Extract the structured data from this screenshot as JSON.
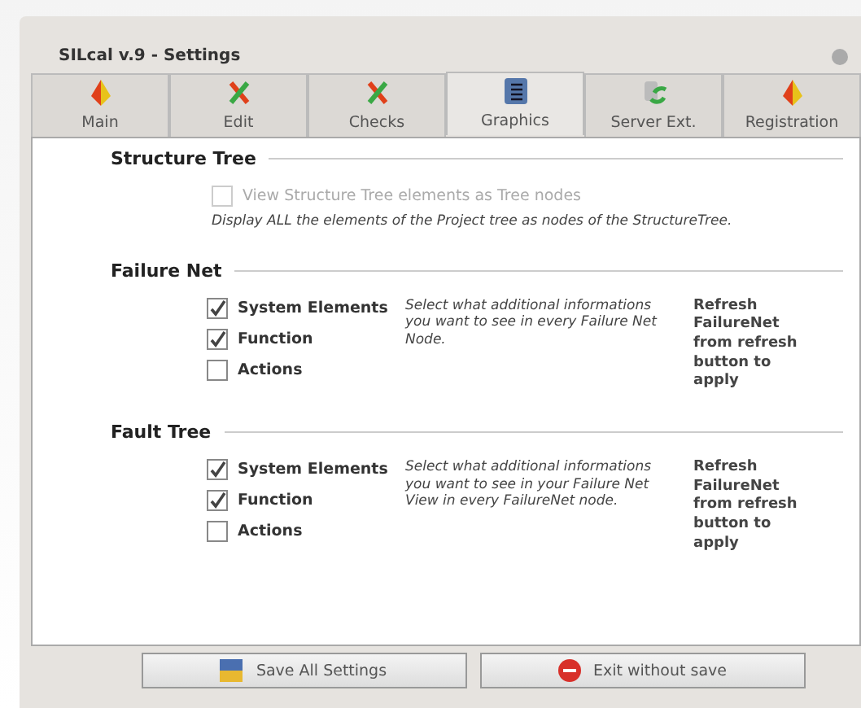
{
  "window": {
    "title": "SILcal v.9 - Settings"
  },
  "tabs": [
    {
      "label": "Main",
      "selected": false
    },
    {
      "label": "Edit",
      "selected": false
    },
    {
      "label": "Checks",
      "selected": false
    },
    {
      "label": "Graphics",
      "selected": true
    },
    {
      "label": "Server Ext.",
      "selected": false
    },
    {
      "label": "Registration",
      "selected": false
    }
  ],
  "sections": [
    {
      "title": "Structure Tree",
      "kind": "stacked",
      "options": [
        {
          "label": "View Structure Tree elements as Tree nodes",
          "checked": false,
          "disabled": true
        }
      ],
      "description": "Display ALL the elements of the Project tree as nodes of the StructureTree."
    },
    {
      "title": "Failure Net",
      "kind": "columns",
      "options": [
        {
          "label": "System Elements",
          "checked": true,
          "disabled": false
        },
        {
          "label": "Function",
          "checked": true,
          "disabled": false
        },
        {
          "label": "Actions",
          "checked": false,
          "disabled": false
        }
      ],
      "description": "Select what additional informations you want to see in every Failure Net Node.",
      "note": "Refresh FailureNet from refresh button to apply"
    },
    {
      "title": "Fault Tree",
      "kind": "columns",
      "options": [
        {
          "label": "System Elements",
          "checked": true,
          "disabled": false
        },
        {
          "label": "Function",
          "checked": true,
          "disabled": false
        },
        {
          "label": "Actions",
          "checked": false,
          "disabled": false
        }
      ],
      "description": "Select what additional informations you want to see in your Failure Net View in every FailureNet node.",
      "note": "Refresh FailureNet from refresh button to apply"
    }
  ],
  "buttons": [
    {
      "label": "Save All Settings",
      "kind": "save"
    },
    {
      "label": "Exit without save",
      "kind": "exit"
    }
  ]
}
